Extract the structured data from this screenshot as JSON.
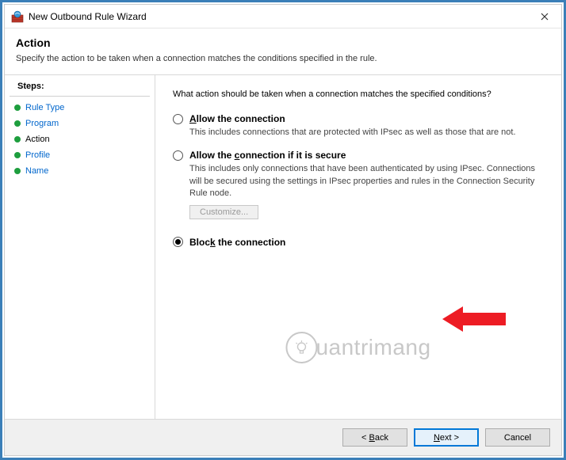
{
  "window": {
    "title": "New Outbound Rule Wizard"
  },
  "header": {
    "title": "Action",
    "subtitle": "Specify the action to be taken when a connection matches the conditions specified in the rule."
  },
  "steps": {
    "heading": "Steps:",
    "items": [
      {
        "label": "Rule Type",
        "state": "link"
      },
      {
        "label": "Program",
        "state": "link"
      },
      {
        "label": "Action",
        "state": "current"
      },
      {
        "label": "Profile",
        "state": "link"
      },
      {
        "label": "Name",
        "state": "link"
      }
    ]
  },
  "content": {
    "question": "What action should be taken when a connection matches the specified conditions?",
    "options": [
      {
        "id": "allow",
        "label": "Allow the connection",
        "desc": "This includes connections that are protected with IPsec as well as those that are not.",
        "selected": false
      },
      {
        "id": "allow-secure",
        "label": "Allow the connection if it is secure",
        "desc": "This includes only connections that have been authenticated by using IPsec. Connections will be secured using the settings in IPsec properties and rules in the Connection Security Rule node.",
        "selected": false,
        "customize_label": "Customize...",
        "customize_enabled": false
      },
      {
        "id": "block",
        "label": "Block the connection",
        "desc": "",
        "selected": true
      }
    ]
  },
  "footer": {
    "back": "< Back",
    "next": "Next >",
    "cancel": "Cancel"
  },
  "watermark": "uantrimang"
}
